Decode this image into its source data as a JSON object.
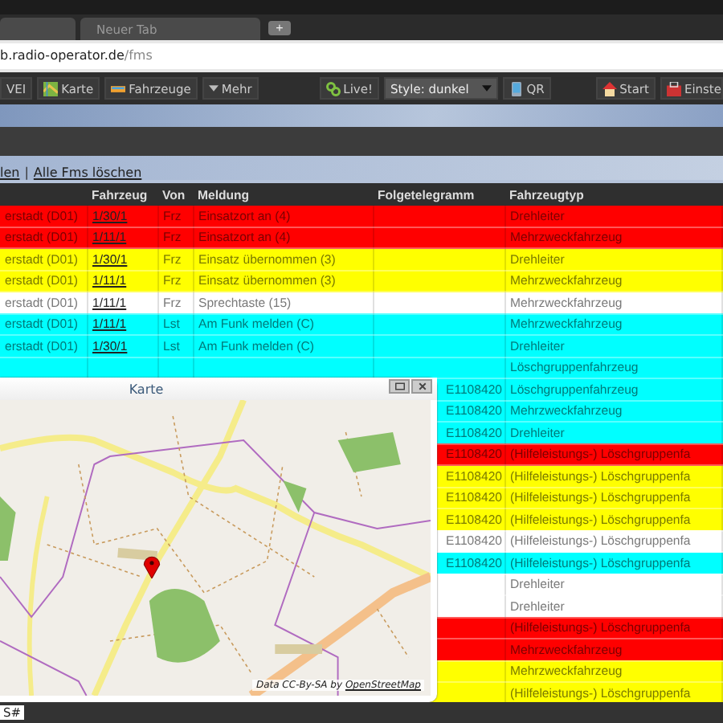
{
  "browser": {
    "tabs": [
      {
        "label": "Neuer Tab"
      }
    ],
    "new_tab": "+",
    "address": {
      "host": "b.radio-operator.de",
      "path": "/fms"
    }
  },
  "toolbar": {
    "vei": "VEI",
    "karte": "Karte",
    "fahrzeuge": "Fahrzeuge",
    "mehr": "Mehr",
    "live": "Live!",
    "style": "Style: dunkel",
    "qr": "QR",
    "start": "Start",
    "einstellungen": "Einste"
  },
  "links": {
    "items": [
      "len",
      "Alle Fms löschen"
    ],
    "separator": "|"
  },
  "table": {
    "columns": [
      "Fahrzeug",
      "Von",
      "Meldung",
      "Folgetelegramm",
      "Fahrzeugtyp"
    ],
    "rows": [
      {
        "color": "#ff0000",
        "column_1": "erstadt (D01)",
        "fahrzeug": "1/30/1",
        "von": "Frz",
        "meldung": "Einsatzort an (4)",
        "fahrzeugtyp": "Drehleiter"
      },
      {
        "color": "#ff0000",
        "column_1": "erstadt (D01)",
        "fahrzeug": "1/11/1",
        "von": "Frz",
        "meldung": "Einsatzort an (4)",
        "fahrzeugtyp": "Mehrzweckfahrzeug"
      },
      {
        "color": "#ffff00",
        "column_1": "erstadt (D01)",
        "fahrzeug": "1/30/1",
        "von": "Frz",
        "meldung": "Einsatz übernommen (3)",
        "fahrzeugtyp": "Drehleiter"
      },
      {
        "color": "#ffff00",
        "column_1": "erstadt (D01)",
        "fahrzeug": "1/11/1",
        "von": "Frz",
        "meldung": "Einsatz übernommen (3)",
        "fahrzeugtyp": "Mehrzweckfahrzeug"
      },
      {
        "color": "#ffffff",
        "column_1": "erstadt (D01)",
        "fahrzeug": "1/11/1",
        "von": "Frz",
        "meldung": "Sprechtaste (15)",
        "fahrzeugtyp": "Mehrzweckfahrzeug"
      },
      {
        "color": "#00ffff",
        "column_1": "erstadt (D01)",
        "fahrzeug": "1/11/1",
        "von": "Lst",
        "meldung": "Am Funk melden (C)",
        "fahrzeugtyp": "Mehrzweckfahrzeug"
      },
      {
        "color": "#00ffff",
        "column_1": "erstadt (D01)",
        "fahrzeug": "1/30/1",
        "von": "Lst",
        "meldung": "Am Funk melden (C)",
        "fahrzeugtyp": "Drehleiter"
      },
      {
        "color": "#00ffff",
        "fahrzeugtyp": "Löschgruppenfahrzeug"
      },
      {
        "color": "#00ffff",
        "folgetelegramm": "E1108420",
        "fahrzeugtyp": "Löschgruppenfahrzeug"
      },
      {
        "color": "#00ffff",
        "folgetelegramm": "E1108420",
        "fahrzeugtyp": "Mehrzweckfahrzeug"
      },
      {
        "color": "#00ffff",
        "folgetelegramm": "E1108420",
        "fahrzeugtyp": "Drehleiter"
      },
      {
        "color": "#ff0000",
        "folgetelegramm": "E1108420",
        "fahrzeugtyp": "(Hilfeleistungs-) Löschgruppenfa"
      },
      {
        "color": "#ffff00",
        "folgetelegramm": "E1108420",
        "fahrzeugtyp": "(Hilfeleistungs-) Löschgruppenfa"
      },
      {
        "color": "#ffff00",
        "folgetelegramm": "E1108420",
        "fahrzeugtyp": "(Hilfeleistungs-) Löschgruppenfa"
      },
      {
        "color": "#ffff00",
        "folgetelegramm": "E1108420",
        "fahrzeugtyp": "(Hilfeleistungs-) Löschgruppenfa"
      },
      {
        "color": "#ffffff",
        "folgetelegramm": "E1108420",
        "fahrzeugtyp": "(Hilfeleistungs-) Löschgruppenfa"
      },
      {
        "color": "#00ffff",
        "folgetelegramm": "E1108420",
        "fahrzeugtyp": "(Hilfeleistungs-) Löschgruppenfa"
      },
      {
        "color": "#ffffff",
        "fahrzeugtyp": "Drehleiter"
      },
      {
        "color": "#ffffff",
        "fahrzeugtyp": "Drehleiter"
      },
      {
        "color": "#ff0000",
        "fahrzeugtyp": "(Hilfeleistungs-) Löschgruppenfa"
      },
      {
        "color": "#ff0000",
        "fahrzeugtyp": "Mehrzweckfahrzeug"
      },
      {
        "color": "#ffff00",
        "fahrzeugtyp": "Mehrzweckfahrzeug"
      },
      {
        "color": "#ffff00",
        "fahrzeugtyp": "(Hilfeleistungs-) Löschgruppenfa"
      }
    ]
  },
  "map_window": {
    "title": "Karte",
    "attribution": "Data CC-By-SA by",
    "attribution_link": "OpenStreetMap"
  },
  "status_bar": {
    "label": "S#"
  }
}
